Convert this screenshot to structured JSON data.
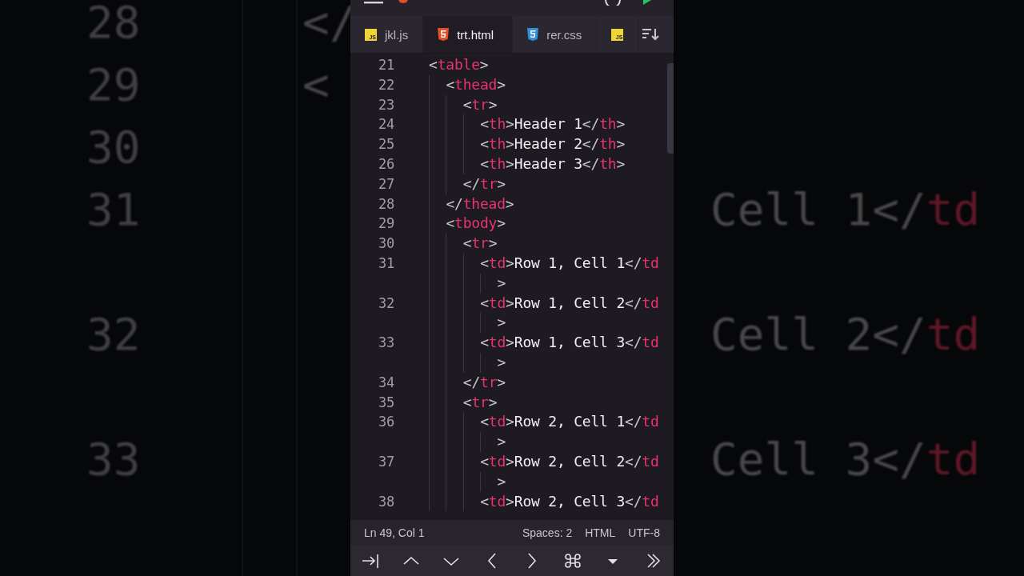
{
  "backdrop": {
    "rows": [
      {
        "num": "28",
        "left_code": [
          {
            "kind": "punct",
            "text": "</"
          }
        ]
      },
      {
        "num": "29",
        "left_code": [
          {
            "kind": "punct",
            "text": "<"
          }
        ]
      },
      {
        "num": "30"
      },
      {
        "num": "31",
        "right_code": [
          {
            "kind": "text",
            "text": "Cell 1</"
          },
          {
            "kind": "tag",
            "text": "td"
          }
        ],
        "wrapped": true
      },
      {
        "num": "32",
        "right_code": [
          {
            "kind": "text",
            "text": "Cell 2</"
          },
          {
            "kind": "tag",
            "text": "td"
          }
        ],
        "wrapped": true
      },
      {
        "num": "33",
        "right_code": [
          {
            "kind": "text",
            "text": "Cell 3</"
          },
          {
            "kind": "tag",
            "text": "td"
          }
        ],
        "wrapped": true
      }
    ]
  },
  "tabs": [
    {
      "kind": "js",
      "icon_label": "JS",
      "label": "jkl.js",
      "selected": false
    },
    {
      "kind": "html",
      "label": "trt.html",
      "selected": true
    },
    {
      "kind": "css",
      "label": "rer.css",
      "selected": false
    },
    {
      "kind": "js",
      "icon_label": "JS",
      "selected": false
    }
  ],
  "editor": {
    "lines": [
      {
        "num": "21",
        "code": [
          {
            "kind": "punct",
            "text": "<"
          },
          {
            "kind": "tag",
            "text": "table"
          },
          {
            "kind": "punct",
            "text": ">"
          }
        ],
        "children": [
          {
            "num": "22",
            "code": [
              {
                "kind": "punct",
                "text": "<"
              },
              {
                "kind": "tag",
                "text": "thead"
              },
              {
                "kind": "punct",
                "text": ">"
              }
            ],
            "children": [
              {
                "num": "23",
                "code": [
                  {
                    "kind": "punct",
                    "text": "<"
                  },
                  {
                    "kind": "tag",
                    "text": "tr"
                  },
                  {
                    "kind": "punct",
                    "text": ">"
                  }
                ],
                "children": [
                  {
                    "num": "24",
                    "code": [
                      {
                        "kind": "punct",
                        "text": "<"
                      },
                      {
                        "kind": "tag",
                        "text": "th"
                      },
                      {
                        "kind": "punct",
                        "text": ">"
                      },
                      {
                        "kind": "text",
                        "text": "Header 1"
                      },
                      {
                        "kind": "punct",
                        "text": "</"
                      },
                      {
                        "kind": "tag",
                        "text": "th"
                      },
                      {
                        "kind": "punct",
                        "text": ">"
                      }
                    ]
                  },
                  {
                    "num": "25",
                    "code": [
                      {
                        "kind": "punct",
                        "text": "<"
                      },
                      {
                        "kind": "tag",
                        "text": "th"
                      },
                      {
                        "kind": "punct",
                        "text": ">"
                      },
                      {
                        "kind": "text",
                        "text": "Header 2"
                      },
                      {
                        "kind": "punct",
                        "text": "</"
                      },
                      {
                        "kind": "tag",
                        "text": "th"
                      },
                      {
                        "kind": "punct",
                        "text": ">"
                      }
                    ]
                  },
                  {
                    "num": "26",
                    "code": [
                      {
                        "kind": "punct",
                        "text": "<"
                      },
                      {
                        "kind": "tag",
                        "text": "th"
                      },
                      {
                        "kind": "punct",
                        "text": ">"
                      },
                      {
                        "kind": "text",
                        "text": "Header 3"
                      },
                      {
                        "kind": "punct",
                        "text": "</"
                      },
                      {
                        "kind": "tag",
                        "text": "th"
                      },
                      {
                        "kind": "punct",
                        "text": ">"
                      }
                    ]
                  }
                ]
              },
              {
                "num": "27",
                "code": [
                  {
                    "kind": "punct",
                    "text": "</"
                  },
                  {
                    "kind": "tag",
                    "text": "tr"
                  },
                  {
                    "kind": "punct",
                    "text": ">"
                  }
                ]
              }
            ]
          },
          {
            "num": "28",
            "code": [
              {
                "kind": "punct",
                "text": "</"
              },
              {
                "kind": "tag",
                "text": "thead"
              },
              {
                "kind": "punct",
                "text": ">"
              }
            ]
          },
          {
            "num": "29",
            "code": [
              {
                "kind": "punct",
                "text": "<"
              },
              {
                "kind": "tag",
                "text": "tbody"
              },
              {
                "kind": "punct",
                "text": ">"
              }
            ],
            "children": [
              {
                "num": "30",
                "code": [
                  {
                    "kind": "punct",
                    "text": "<"
                  },
                  {
                    "kind": "tag",
                    "text": "tr"
                  },
                  {
                    "kind": "punct",
                    "text": ">"
                  }
                ],
                "children": [
                  {
                    "num": "31",
                    "code": [
                      {
                        "kind": "punct",
                        "text": "<"
                      },
                      {
                        "kind": "tag",
                        "text": "td"
                      },
                      {
                        "kind": "punct",
                        "text": ">"
                      },
                      {
                        "kind": "text",
                        "text": "Row 1, Cell 1"
                      },
                      {
                        "kind": "punct",
                        "text": "</"
                      },
                      {
                        "kind": "tag",
                        "text": "td"
                      }
                    ],
                    "continuation": [
                      {
                        "kind": "punct",
                        "text": ">"
                      }
                    ]
                  },
                  {
                    "num": "32",
                    "code": [
                      {
                        "kind": "punct",
                        "text": "<"
                      },
                      {
                        "kind": "tag",
                        "text": "td"
                      },
                      {
                        "kind": "punct",
                        "text": ">"
                      },
                      {
                        "kind": "text",
                        "text": "Row 1, Cell 2"
                      },
                      {
                        "kind": "punct",
                        "text": "</"
                      },
                      {
                        "kind": "tag",
                        "text": "td"
                      }
                    ],
                    "continuation": [
                      {
                        "kind": "punct",
                        "text": ">"
                      }
                    ]
                  },
                  {
                    "num": "33",
                    "code": [
                      {
                        "kind": "punct",
                        "text": "<"
                      },
                      {
                        "kind": "tag",
                        "text": "td"
                      },
                      {
                        "kind": "punct",
                        "text": ">"
                      },
                      {
                        "kind": "text",
                        "text": "Row 1, Cell 3"
                      },
                      {
                        "kind": "punct",
                        "text": "</"
                      },
                      {
                        "kind": "tag",
                        "text": "td"
                      }
                    ],
                    "continuation": [
                      {
                        "kind": "punct",
                        "text": ">"
                      }
                    ]
                  }
                ]
              },
              {
                "num": "34",
                "code": [
                  {
                    "kind": "punct",
                    "text": "</"
                  },
                  {
                    "kind": "tag",
                    "text": "tr"
                  },
                  {
                    "kind": "punct",
                    "text": ">"
                  }
                ]
              },
              {
                "num": "35",
                "code": [
                  {
                    "kind": "punct",
                    "text": "<"
                  },
                  {
                    "kind": "tag",
                    "text": "tr"
                  },
                  {
                    "kind": "punct",
                    "text": ">"
                  }
                ],
                "children": [
                  {
                    "num": "36",
                    "code": [
                      {
                        "kind": "punct",
                        "text": "<"
                      },
                      {
                        "kind": "tag",
                        "text": "td"
                      },
                      {
                        "kind": "punct",
                        "text": ">"
                      },
                      {
                        "kind": "text",
                        "text": "Row 2, Cell 1"
                      },
                      {
                        "kind": "punct",
                        "text": "</"
                      },
                      {
                        "kind": "tag",
                        "text": "td"
                      }
                    ],
                    "continuation": [
                      {
                        "kind": "punct",
                        "text": ">"
                      }
                    ]
                  },
                  {
                    "num": "37",
                    "code": [
                      {
                        "kind": "punct",
                        "text": "<"
                      },
                      {
                        "kind": "tag",
                        "text": "td"
                      },
                      {
                        "kind": "punct",
                        "text": ">"
                      },
                      {
                        "kind": "text",
                        "text": "Row 2, Cell 2"
                      },
                      {
                        "kind": "punct",
                        "text": "</"
                      },
                      {
                        "kind": "tag",
                        "text": "td"
                      }
                    ],
                    "continuation": [
                      {
                        "kind": "punct",
                        "text": ">"
                      }
                    ]
                  },
                  {
                    "num": "38",
                    "code": [
                      {
                        "kind": "punct",
                        "text": "<"
                      },
                      {
                        "kind": "tag",
                        "text": "td"
                      },
                      {
                        "kind": "punct",
                        "text": ">"
                      },
                      {
                        "kind": "text",
                        "text": "Row 2, Cell 3"
                      },
                      {
                        "kind": "punct",
                        "text": "</"
                      },
                      {
                        "kind": "tag",
                        "text": "td"
                      }
                    ]
                  }
                ]
              }
            ]
          }
        ]
      }
    ]
  },
  "status_bar": {
    "position": "Ln 49, Col 1",
    "indentation": "Spaces: 2",
    "language": "HTML",
    "encoding": "UTF-8"
  }
}
